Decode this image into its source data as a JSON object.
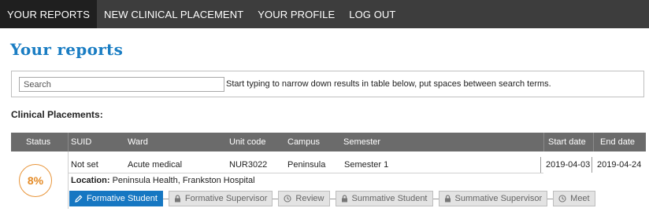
{
  "nav": {
    "items": [
      {
        "label": "YOUR REPORTS",
        "active": true
      },
      {
        "label": "NEW CLINICAL PLACEMENT",
        "active": false
      },
      {
        "label": "YOUR PROFILE",
        "active": false
      },
      {
        "label": "LOG OUT",
        "active": false
      }
    ]
  },
  "page_title": "Your reports",
  "search": {
    "placeholder": "Search",
    "value": "",
    "hint": "Start typing to narrow down results in table below, put spaces between search terms."
  },
  "section_title": "Clinical Placements:",
  "table": {
    "headers": {
      "status": "Status",
      "suid": "SUID",
      "ward": "Ward",
      "unit_code": "Unit code",
      "campus": "Campus",
      "semester": "Semester",
      "start_date": "Start date",
      "end_date": "End date"
    },
    "rows": [
      {
        "status": "8%",
        "suid": "Not set",
        "ward": "Acute medical",
        "unit_code": "NUR3022",
        "campus": "Peninsula",
        "semester": "Semester 1",
        "start_date": "2019-04-03",
        "end_date": "2019-04-24",
        "location_label": "Location:",
        "location_value": "Peninsula Health, Frankston Hospital",
        "steps": [
          {
            "label": "Formative Student",
            "icon": "pencil-icon",
            "active": true
          },
          {
            "label": "Formative Supervisor",
            "icon": "lock-icon",
            "active": false
          },
          {
            "label": "Review",
            "icon": "clock-icon",
            "active": false
          },
          {
            "label": "Summative Student",
            "icon": "lock-icon",
            "active": false
          },
          {
            "label": "Summative Supervisor",
            "icon": "lock-icon",
            "active": false
          },
          {
            "label": "Meet",
            "icon": "clock-icon",
            "active": false
          }
        ]
      }
    ]
  },
  "colors": {
    "nav_bg": "#3d3d3d",
    "title_blue": "#1a7dc3",
    "status_orange": "#e8953a",
    "active_step": "#1677c2"
  }
}
